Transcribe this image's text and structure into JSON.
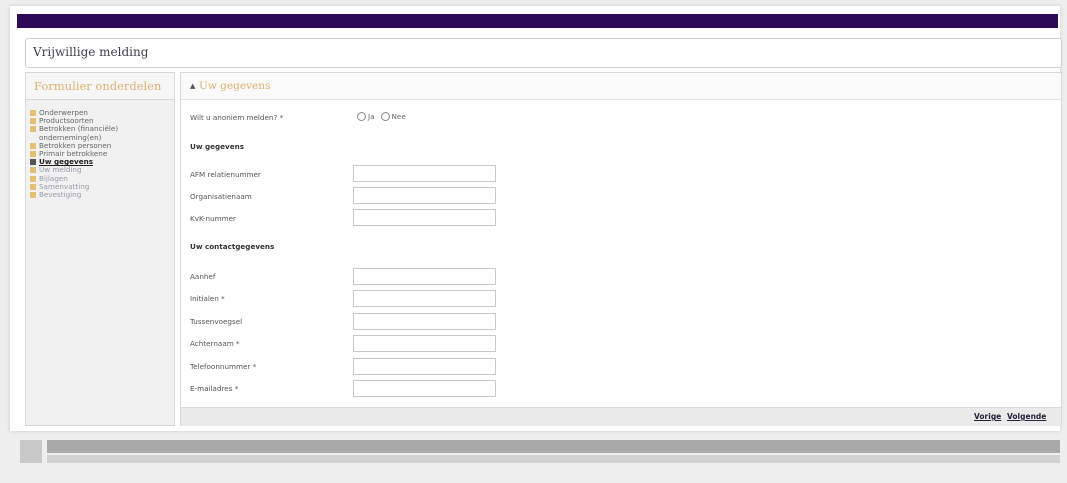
{
  "header": {
    "title": "Vrijwillige melding"
  },
  "sidebar": {
    "title": "Formulier onderdelen",
    "items": [
      {
        "label": "Onderwerpen",
        "state": "done"
      },
      {
        "label": "Productsoorten",
        "state": "done"
      },
      {
        "label": "Betrokken (financiële) onderneming(en)",
        "state": "done"
      },
      {
        "label": "Betrokken personen",
        "state": "done"
      },
      {
        "label": "Primair betrokkene",
        "state": "done"
      },
      {
        "label": "Uw gegevens",
        "state": "active"
      },
      {
        "label": "Uw melding",
        "state": "todo"
      },
      {
        "label": "Bijlagen",
        "state": "todo"
      },
      {
        "label": "Samenvatting",
        "state": "todo"
      },
      {
        "label": "Bevestiging",
        "state": "todo"
      }
    ]
  },
  "main": {
    "section_title": "Uw gegevens",
    "anon_question": "Wilt u anoniem melden? *",
    "anon_options": [
      "Ja",
      "Nee"
    ],
    "group1_title": "Uw gegevens",
    "group1_fields": [
      {
        "label": "AFM relatienummer",
        "value": ""
      },
      {
        "label": "Organisatienaam",
        "value": ""
      },
      {
        "label": "KvK-nummer",
        "value": ""
      }
    ],
    "group2_title": "Uw contactgegevens",
    "group2_fields": [
      {
        "label": "Aanhef",
        "value": ""
      },
      {
        "label": "Initialen *",
        "value": ""
      },
      {
        "label": "Tussenvoegsel",
        "value": ""
      },
      {
        "label": "Achternaam *",
        "value": ""
      },
      {
        "label": "Telefoonnummer *",
        "value": ""
      },
      {
        "label": "E-mailadres *",
        "value": ""
      }
    ]
  },
  "footer": {
    "prev_label": "Vorige",
    "next_label": "Volgende"
  },
  "colors": {
    "brand_bar": "#2d0a58",
    "accent": "#e0b070"
  }
}
